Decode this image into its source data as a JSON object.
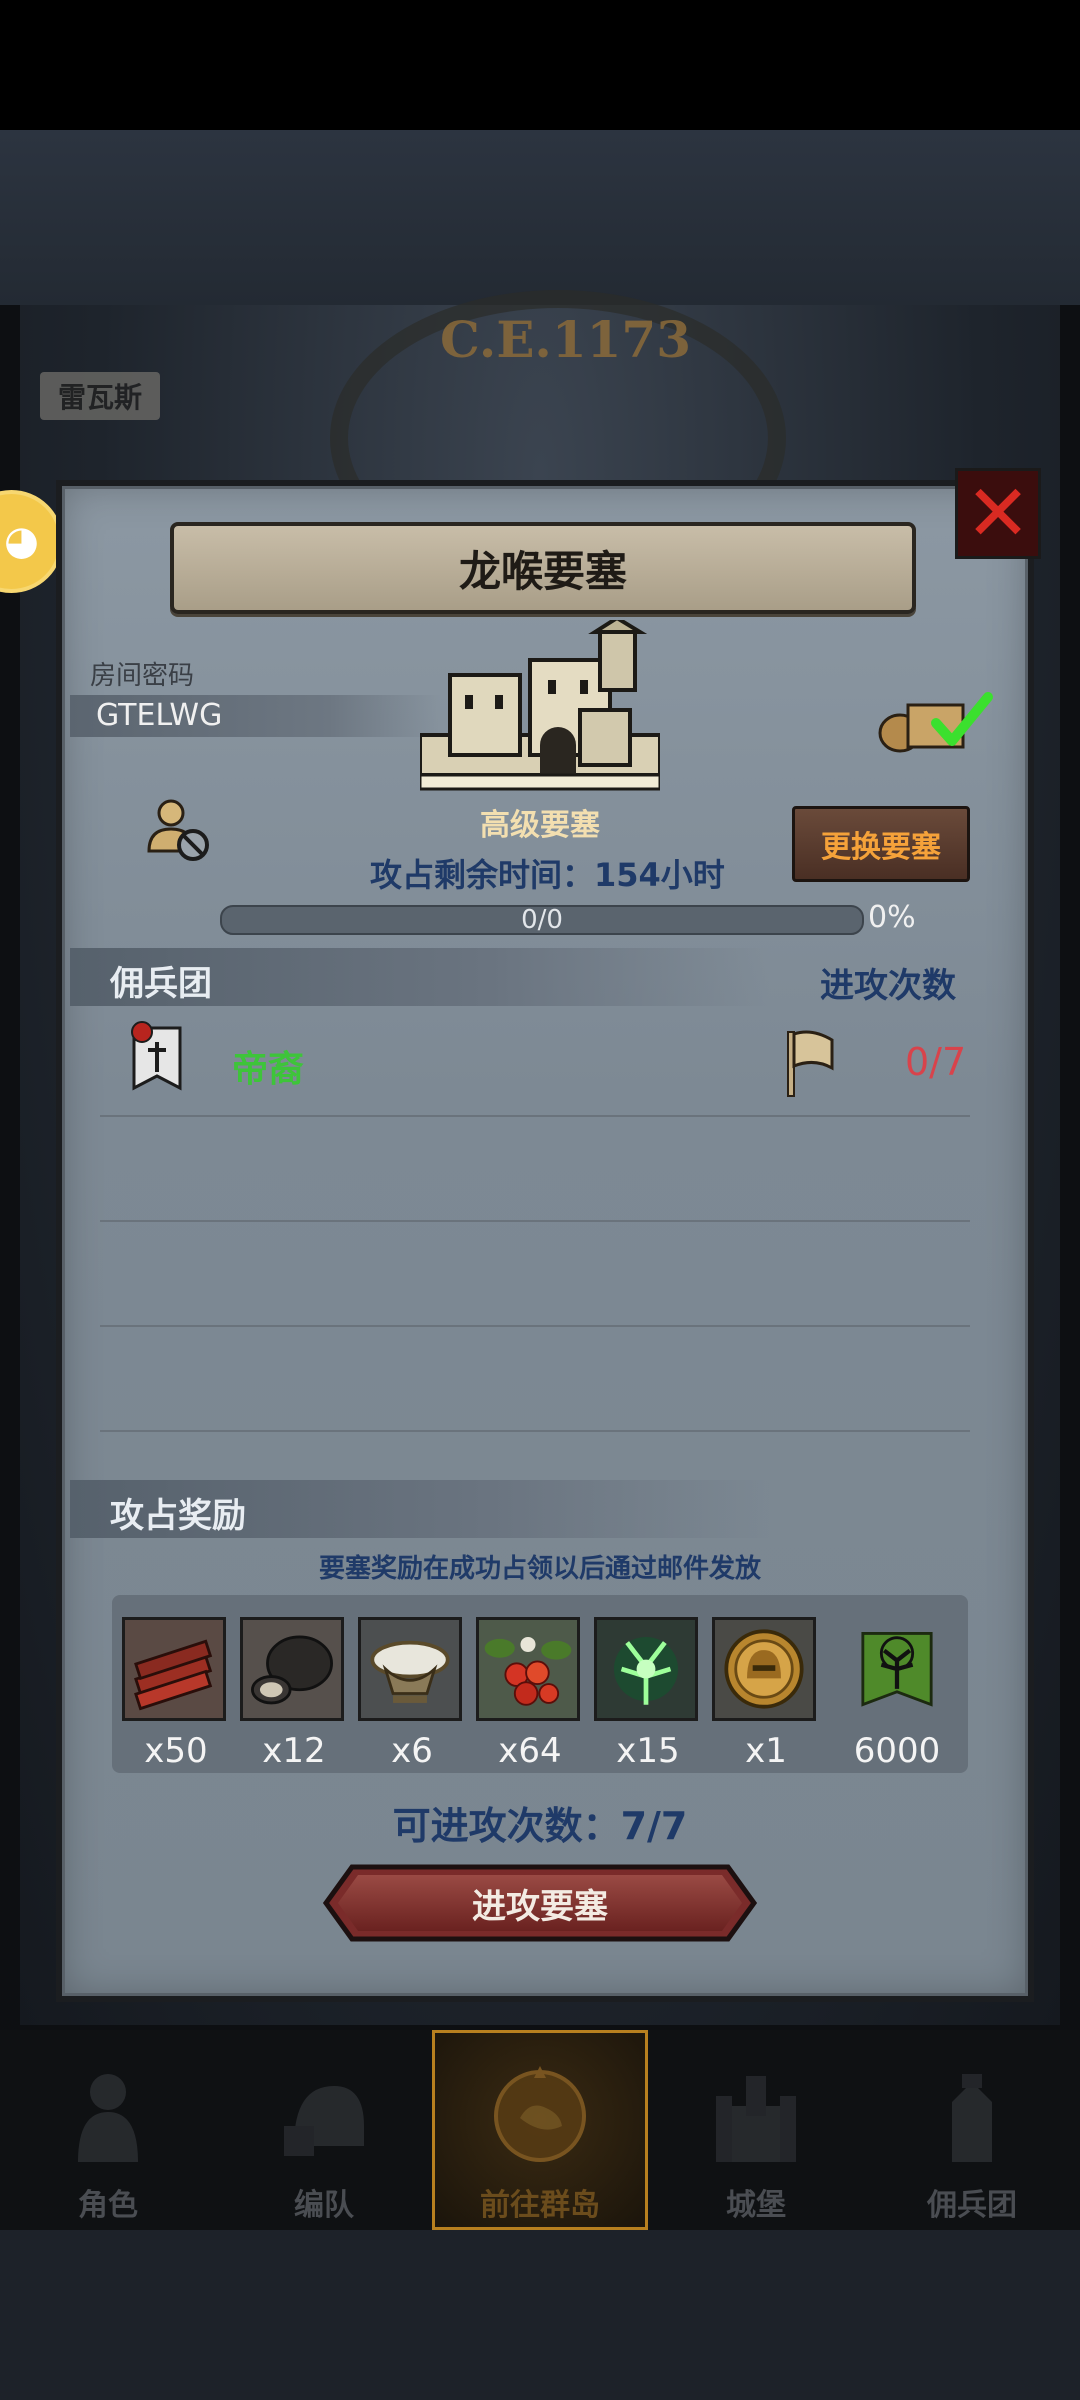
{
  "background": {
    "year": "C.E.1173",
    "city_label": "雷瓦斯"
  },
  "panel": {
    "title": "龙喉要塞",
    "room_code_label": "房间密码",
    "room_code": "GTELWG",
    "fortress_type": "高级要塞",
    "change_button": "更换要塞",
    "remaining_time": "攻占剩余时间：154小时",
    "progress_text": "0/0",
    "progress_fraction": 0,
    "progress_percent": "0%",
    "mercenary_header": "佣兵团",
    "attack_count_header": "进攻次数",
    "mercenaries": [
      {
        "name": "帝裔",
        "attacks": "0/7"
      }
    ],
    "reward_header": "攻占奖励",
    "reward_note": "要塞奖励在成功占领以后通过邮件发放",
    "rewards": [
      {
        "icon": "wood-logs-icon",
        "qty": "x50"
      },
      {
        "icon": "truffle-icon",
        "qty": "x12"
      },
      {
        "icon": "salt-bowl-icon",
        "qty": "x6"
      },
      {
        "icon": "berries-icon",
        "qty": "x64"
      },
      {
        "icon": "green-spirit-icon",
        "qty": "x15"
      },
      {
        "icon": "gold-helmet-coin-icon",
        "qty": "x1"
      },
      {
        "icon": "tree-banner-icon",
        "qty": "6000"
      }
    ],
    "available_attacks": "可进攻次数：7/7",
    "attack_button": "进攻要塞"
  },
  "nav": {
    "items": [
      {
        "label": "角色",
        "icon": "knight-icon"
      },
      {
        "label": "编队",
        "icon": "helmet-formation-icon"
      },
      {
        "label": "前往群岛",
        "icon": "compass-map-icon",
        "active": true
      },
      {
        "label": "城堡",
        "icon": "castle-icon"
      },
      {
        "label": "佣兵团",
        "icon": "mercenary-icon"
      }
    ]
  }
}
